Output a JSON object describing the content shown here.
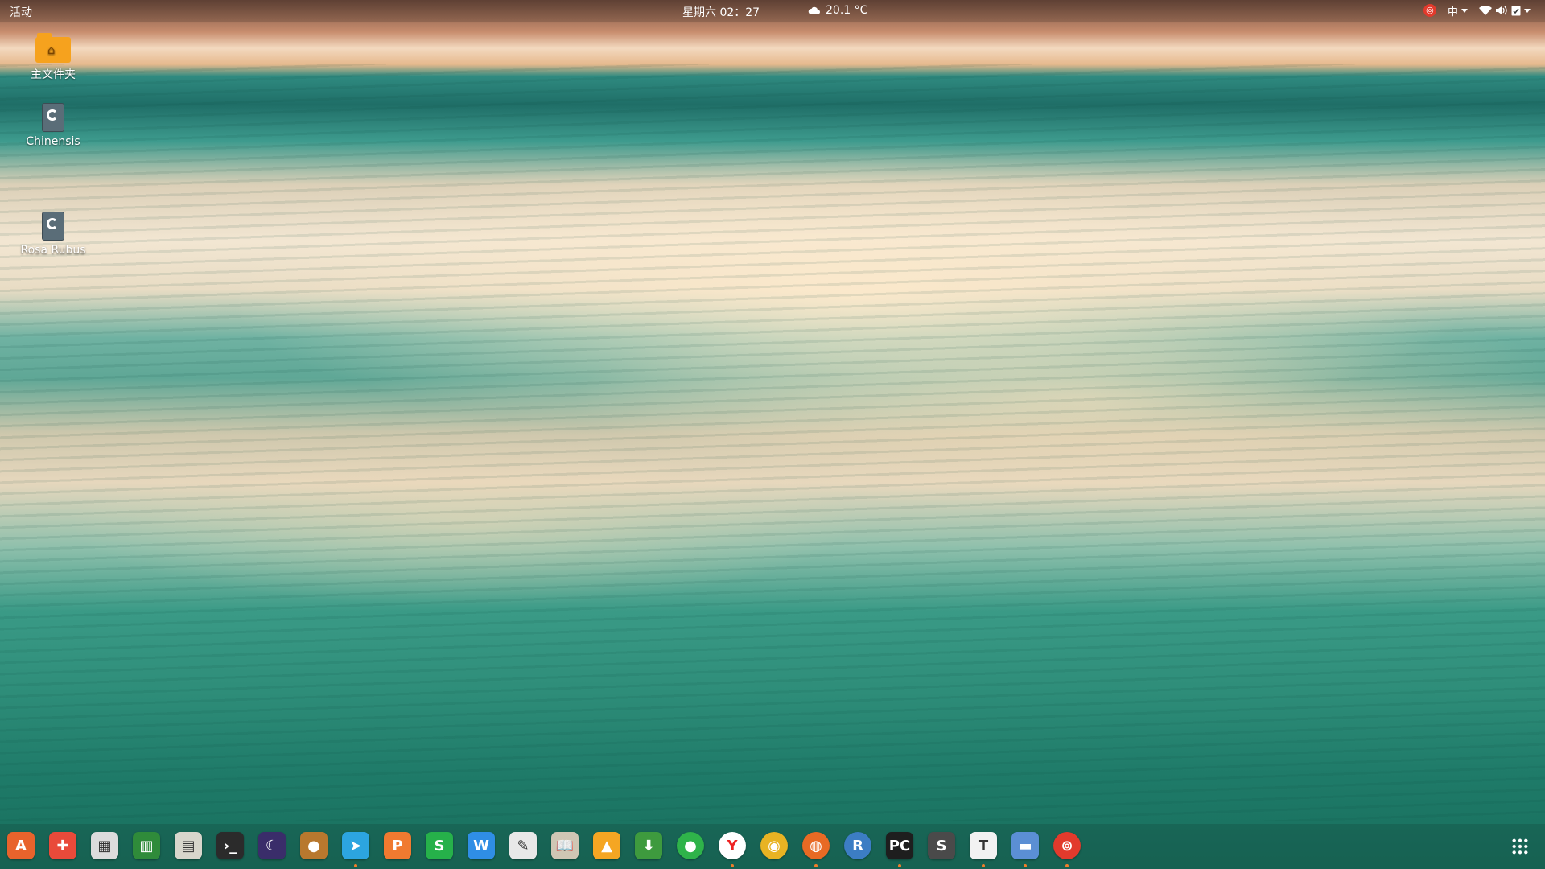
{
  "topbar": {
    "activities": "活动",
    "clock": "星期六 02：27",
    "weather": "20.1 °C",
    "tray": {
      "netease_icon": "netease-music-icon",
      "input_method": "中",
      "wifi_icon": "wifi-icon",
      "volume_icon": "volume-icon",
      "clipboard_icon": "clipboard-check-icon"
    }
  },
  "desktop": {
    "icons": [
      {
        "label": "主文件夹",
        "icon": "home-folder-icon"
      },
      {
        "label": "Chinensis",
        "icon": "drive-icon"
      },
      {
        "label": "Rosa Rubus",
        "icon": "drive-icon"
      }
    ]
  },
  "dock": {
    "apps": [
      {
        "name": "software-center",
        "glyph": "A",
        "color": "#e8632c"
      },
      {
        "name": "help",
        "glyph": "✚",
        "color": "#e94a3a"
      },
      {
        "name": "mixer",
        "glyph": "▦",
        "color": "#dcdcdc"
      },
      {
        "name": "system-monitor",
        "glyph": "▥",
        "color": "#2f8b3a"
      },
      {
        "name": "calculator",
        "glyph": "▤",
        "color": "#d8d6cc"
      },
      {
        "name": "terminal",
        "glyph": "›_",
        "color": "#2b2b2b"
      },
      {
        "name": "night-app",
        "glyph": "☾",
        "color": "#3a2d6a"
      },
      {
        "name": "acorn-app",
        "glyph": "●",
        "color": "#b8782e"
      },
      {
        "name": "telegram",
        "glyph": "➤",
        "color": "#2ca5e0"
      },
      {
        "name": "wps-presentation",
        "glyph": "P",
        "color": "#f07a30"
      },
      {
        "name": "wps-spreadsheet",
        "glyph": "S",
        "color": "#26b14a"
      },
      {
        "name": "wps-writer",
        "glyph": "W",
        "color": "#2f8ee5"
      },
      {
        "name": "text-editor",
        "glyph": "✎",
        "color": "#e8e8e8"
      },
      {
        "name": "book-reader",
        "glyph": "📖",
        "color": "#cfc6b4"
      },
      {
        "name": "vlc",
        "glyph": "▲",
        "color": "#f5a623"
      },
      {
        "name": "downloader",
        "glyph": "⬇",
        "color": "#3e9a3e"
      },
      {
        "name": "wechat",
        "glyph": "●",
        "color": "#2fb34a"
      },
      {
        "name": "yandex-browser",
        "glyph": "Y",
        "color": "#ffffff"
      },
      {
        "name": "chrome",
        "glyph": "◉",
        "color": "#e8b323"
      },
      {
        "name": "firefox",
        "glyph": "◍",
        "color": "#e86a24"
      },
      {
        "name": "rstudio",
        "glyph": "R",
        "color": "#3c7dc4"
      },
      {
        "name": "pycharm",
        "glyph": "PC",
        "color": "#1e1e1e"
      },
      {
        "name": "sublime-text",
        "glyph": "S",
        "color": "#4a4a4a"
      },
      {
        "name": "typora",
        "glyph": "T",
        "color": "#f2f2f2"
      },
      {
        "name": "file-manager",
        "glyph": "▬",
        "color": "#5b8fd4"
      },
      {
        "name": "netease-music",
        "glyph": "⊚",
        "color": "#e23a2c"
      }
    ],
    "show_apps_icon": "app-grid-icon"
  }
}
